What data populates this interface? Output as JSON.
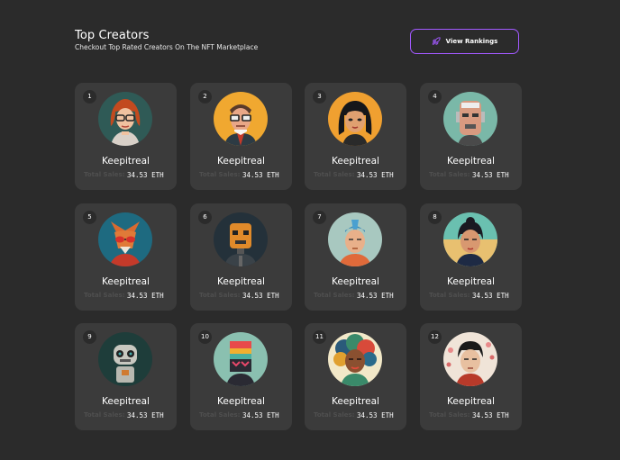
{
  "header": {
    "title": "Top Creators",
    "subtitle": "Checkout Top Rated Creators On The NFT Marketplace",
    "button_label": "View Rankings",
    "button_icon": "rocket-icon",
    "accent": "#a259ff"
  },
  "creators": [
    {
      "rank": "1",
      "name": "Keepitreal",
      "sales_label": "Total Sales:",
      "sales_value": "34.53 ETH",
      "avatar": "red-haired-woman-glasses-avatar"
    },
    {
      "rank": "2",
      "name": "Keepitreal",
      "sales_label": "Total Sales:",
      "sales_value": "34.53 ETH",
      "avatar": "man-glasses-tie-avatar"
    },
    {
      "rank": "3",
      "name": "Keepitreal",
      "sales_label": "Total Sales:",
      "sales_value": "34.53 ETH",
      "avatar": "dark-haired-woman-bangs-avatar"
    },
    {
      "rank": "4",
      "name": "Keepitreal",
      "sales_label": "Total Sales:",
      "sales_value": "34.53 ETH",
      "avatar": "robot-face-avatar"
    },
    {
      "rank": "5",
      "name": "Keepitreal",
      "sales_label": "Total Sales:",
      "sales_value": "34.53 ETH",
      "avatar": "fox-sunglasses-avatar"
    },
    {
      "rank": "6",
      "name": "Keepitreal",
      "sales_label": "Total Sales:",
      "sales_value": "34.53 ETH",
      "avatar": "orange-robot-avatar"
    },
    {
      "rank": "7",
      "name": "Keepitreal",
      "sales_label": "Total Sales:",
      "sales_value": "34.53 ETH",
      "avatar": "blue-haired-man-avatar"
    },
    {
      "rank": "8",
      "name": "Keepitreal",
      "sales_label": "Total Sales:",
      "sales_value": "34.53 ETH",
      "avatar": "asian-woman-avatar"
    },
    {
      "rank": "9",
      "name": "Keepitreal",
      "sales_label": "Total Sales:",
      "sales_value": "34.53 ETH",
      "avatar": "small-robot-avatar"
    },
    {
      "rank": "10",
      "name": "Keepitreal",
      "sales_label": "Total Sales:",
      "sales_value": "34.53 ETH",
      "avatar": "colorful-robot-avatar"
    },
    {
      "rank": "11",
      "name": "Keepitreal",
      "sales_label": "Total Sales:",
      "sales_value": "34.53 ETH",
      "avatar": "afro-woman-avatar"
    },
    {
      "rank": "12",
      "name": "Keepitreal",
      "sales_label": "Total Sales:",
      "sales_value": "34.53 ETH",
      "avatar": "man-cherry-blossom-avatar"
    }
  ]
}
